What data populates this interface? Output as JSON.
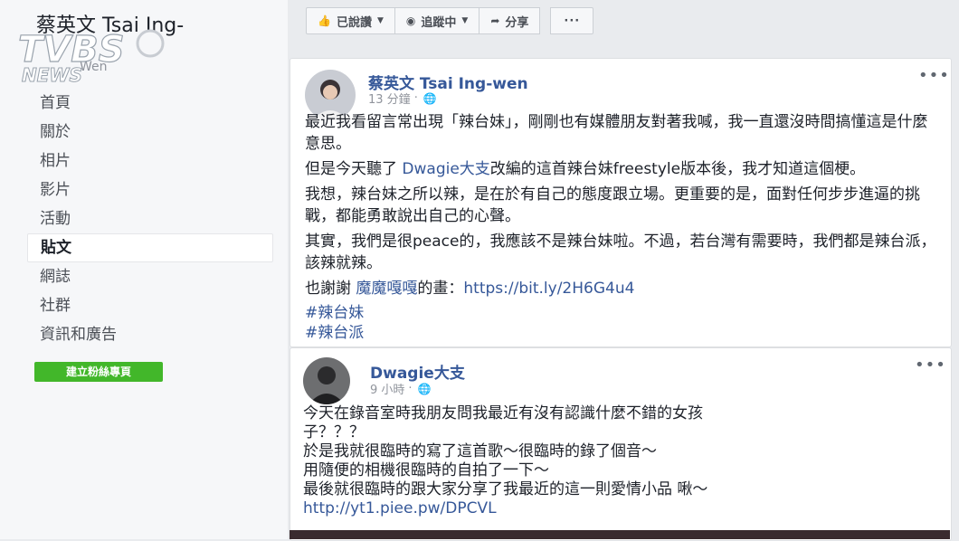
{
  "sidebar": {
    "page_name": "蔡英文 Tsai Ing-",
    "page_subtitle": "Wen",
    "logo_text": "TVBS NEWS",
    "nav": [
      "首頁",
      "關於",
      "相片",
      "影片",
      "活動",
      "貼文",
      "網誌",
      "社群",
      "資訊和廣告"
    ],
    "active_index": 5,
    "create_page_label": "建立粉絲專頁"
  },
  "actions": {
    "liked_label": "已說讚",
    "follow_label": "追蹤中",
    "share_label": "分享",
    "more_label": "···"
  },
  "post1": {
    "author": "蔡英文 Tsai Ing-wen",
    "time": "13 分鐘",
    "para1": "最近我看留言常出現「辣台妹」，剛剛也有媒體朋友對著我喊，我一直還沒時間搞懂這是什麼意思。",
    "para2_before": "但是今天聽了 ",
    "para2_link": "Dwagie大支",
    "para2_after": "改編的這首辣台妹freestyle版本後，我才知道這個梗。",
    "para3": "我想，辣台妹之所以辣，是在於有自己的態度跟立場。更重要的是，面對任何步步進逼的挑戰，都能勇敢說出自己的心聲。",
    "para4": "其實，我們是很peace的，我應該不是辣台妹啦。不過，若台灣有需要時，我們都是辣台派，該辣就辣。",
    "thanks_before": "也謝謝 ",
    "thanks_link": "魔魔嘎嘎",
    "thanks_after": "的畫：",
    "url": "https://bit.ly/2H6G4u4",
    "hashtags": [
      "#辣台妹",
      "#辣台派"
    ]
  },
  "post2": {
    "author": "Dwagie大支",
    "time": "9 小時",
    "lines": [
      "今天在錄音室時我朋友問我最近有沒有認識什麼不錯的女孩",
      "子？？？",
      "於是我就很臨時的寫了這首歌～很臨時的錄了個音～",
      "用隨便的相機很臨時的自拍了一下～",
      "最後就很臨時的跟大家分享了我最近的這一則愛情小品 啾～"
    ],
    "url": "http://yt1.piee.pw/DPCVL"
  },
  "colors": {
    "link": "#365899",
    "create_button": "#42b72a",
    "background": "#e9ebee"
  }
}
